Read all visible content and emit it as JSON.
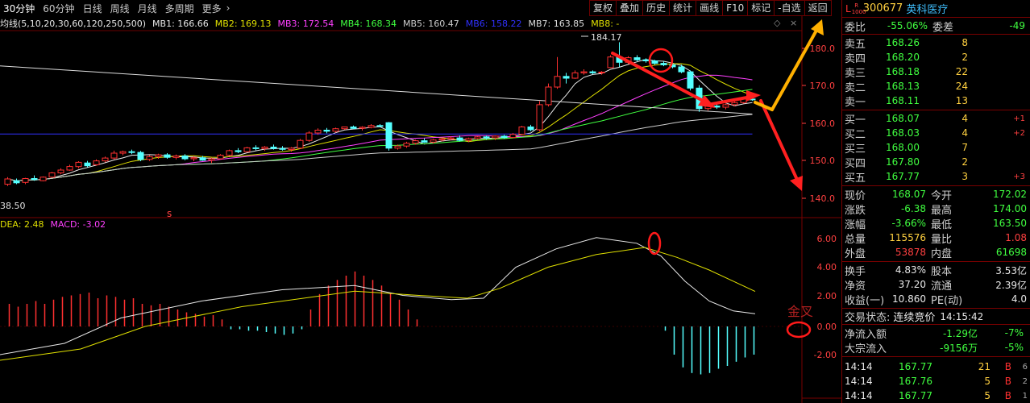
{
  "periods": [
    "30分钟",
    "60分钟",
    "日线",
    "周线",
    "月线",
    "多周期",
    "更多"
  ],
  "toolbar": [
    "复权",
    "叠加",
    "历史",
    "统计",
    "画线",
    "F10",
    "标记",
    "-自选",
    "返回"
  ],
  "ma_legend": {
    "title": "均线(5,10,20,30,60,120,250,500)",
    "items": [
      {
        "label": "MB1: 166.66",
        "color": "#e8e8e8"
      },
      {
        "label": "MB2: 169.13",
        "color": "#e0e000"
      },
      {
        "label": "MB3: 172.54",
        "color": "#ff40ff"
      },
      {
        "label": "MB4: 168.34",
        "color": "#40ff40"
      },
      {
        "label": "MB5: 160.47",
        "color": "#cccccc"
      },
      {
        "label": "MB6: 158.22",
        "color": "#3030ff"
      },
      {
        "label": "MB7: 163.85",
        "color": "#dddddd"
      },
      {
        "label": "MB8: -",
        "color": "#e0e000"
      }
    ]
  },
  "price_axis": [
    "180.0",
    "170.0",
    "160.0",
    "150.0",
    "140.0"
  ],
  "macd_axis": [
    "6.00",
    "4.00",
    "2.00",
    "0.00",
    "-2.00"
  ],
  "price_high_label": "184.17",
  "price_low_label": "38.50",
  "marker_s": "s",
  "macd_legend": {
    "dea": "DEA: 2.48",
    "macd": "MACD: -3.02"
  },
  "annotation_text": "金叉",
  "stock": {
    "marker": "L",
    "badge_top": "R",
    "badge_bottom": "1000",
    "code": "300677",
    "name": "英科医疗"
  },
  "weibi": {
    "label": "委比",
    "value": "-55.06%",
    "label2": "委差",
    "value2": "-49"
  },
  "asks": [
    {
      "label": "卖五",
      "price": "168.26",
      "vol": "8",
      "chg": ""
    },
    {
      "label": "卖四",
      "price": "168.20",
      "vol": "2",
      "chg": ""
    },
    {
      "label": "卖三",
      "price": "168.18",
      "vol": "22",
      "chg": ""
    },
    {
      "label": "卖二",
      "price": "168.13",
      "vol": "24",
      "chg": ""
    },
    {
      "label": "卖一",
      "price": "168.11",
      "vol": "13",
      "chg": ""
    }
  ],
  "bids": [
    {
      "label": "买一",
      "price": "168.07",
      "vol": "4",
      "chg": "+1"
    },
    {
      "label": "买二",
      "price": "168.03",
      "vol": "4",
      "chg": "+2"
    },
    {
      "label": "买三",
      "price": "168.00",
      "vol": "7",
      "chg": ""
    },
    {
      "label": "买四",
      "price": "167.80",
      "vol": "2",
      "chg": ""
    },
    {
      "label": "买五",
      "price": "167.77",
      "vol": "3",
      "chg": "+3"
    }
  ],
  "quote": [
    {
      "l1": "现价",
      "v1": "168.07",
      "c1": "green",
      "l2": "今开",
      "v2": "172.02",
      "c2": "green"
    },
    {
      "l1": "涨跌",
      "v1": "-6.38",
      "c1": "green",
      "l2": "最高",
      "v2": "174.00",
      "c2": "green"
    },
    {
      "l1": "涨幅",
      "v1": "-3.66%",
      "c1": "green",
      "l2": "最低",
      "v2": "163.50",
      "c2": "green"
    },
    {
      "l1": "总量",
      "v1": "115576",
      "c1": "yellow",
      "l2": "量比",
      "v2": "1.08",
      "c2": "red"
    },
    {
      "l1": "外盘",
      "v1": "53878",
      "c1": "red",
      "l2": "内盘",
      "v2": "61698",
      "c2": "green"
    }
  ],
  "finance": [
    {
      "l1": "换手",
      "v1": "4.83%",
      "l2": "股本",
      "v2": "3.53亿"
    },
    {
      "l1": "净资",
      "v1": "37.20",
      "l2": "流通",
      "v2": "2.39亿"
    },
    {
      "l1": "收益(一)",
      "v1": "10.860",
      "l2": "PE(动)",
      "v2": "4.0"
    }
  ],
  "status": {
    "label": "交易状态:",
    "value": "连续竞价",
    "time": "14:15:42"
  },
  "flows": [
    {
      "label": "净流入额",
      "value": "-1.29亿",
      "pct": "-7%"
    },
    {
      "label": "大宗流入",
      "value": "-9156万",
      "pct": "-5%"
    }
  ],
  "trades": [
    {
      "time": "14:14",
      "price": "167.77",
      "vol": "21",
      "side": "B",
      "n": "6"
    },
    {
      "time": "14:14",
      "price": "167.76",
      "vol": "5",
      "side": "B",
      "n": "2"
    },
    {
      "time": "14:14",
      "price": "167.77",
      "vol": "5",
      "side": "B",
      "n": "1"
    }
  ],
  "chart_data": {
    "type": "candlestick",
    "ylim": [
      135,
      187
    ],
    "candles": [
      [
        144,
        146,
        143.5,
        145.5
      ],
      [
        145,
        145.6,
        144,
        144.4
      ],
      [
        144.5,
        145.8,
        144,
        145.6
      ],
      [
        145.6,
        146.5,
        145,
        145.3
      ],
      [
        145,
        146.2,
        144.8,
        146
      ],
      [
        146,
        147.5,
        145.8,
        147.2
      ],
      [
        147.2,
        148.5,
        146.8,
        148
      ],
      [
        148,
        149.5,
        147.8,
        149
      ],
      [
        149,
        150.5,
        148.5,
        150.2
      ],
      [
        150,
        150.6,
        148.8,
        149.2
      ],
      [
        149.5,
        151,
        149.2,
        150.6
      ],
      [
        150.6,
        151.8,
        150.2,
        151.4
      ],
      [
        151.4,
        153.5,
        151,
        152.8
      ],
      [
        152.8,
        153.5,
        152.2,
        153.2
      ],
      [
        153.2,
        153.8,
        152.5,
        153
      ],
      [
        153,
        153.4,
        150.5,
        151
      ],
      [
        151,
        152.2,
        150.6,
        151.8
      ],
      [
        151.8,
        152.6,
        151.2,
        152.3
      ],
      [
        152.3,
        152.8,
        151.2,
        151.6
      ],
      [
        151.6,
        152.4,
        151,
        152
      ],
      [
        152,
        152.5,
        150.8,
        151.2
      ],
      [
        151.2,
        152,
        150.5,
        151.5
      ],
      [
        151.5,
        152,
        150.6,
        150.8
      ],
      [
        150.8,
        151.5,
        150,
        151.2
      ],
      [
        151.2,
        152.5,
        151,
        152.2
      ],
      [
        152.2,
        153.8,
        152,
        153.5
      ],
      [
        153.5,
        154.2,
        152.8,
        153.2
      ],
      [
        153.2,
        154.6,
        153,
        154.3
      ],
      [
        154.3,
        155,
        153.6,
        154.1
      ],
      [
        154.1,
        154.8,
        153.4,
        154.5
      ],
      [
        154.5,
        155.2,
        153.8,
        154.1
      ],
      [
        154.1,
        154.8,
        153.5,
        153.9
      ],
      [
        153.8,
        154.5,
        153.2,
        154.2
      ],
      [
        154.2,
        156.8,
        154,
        156.4
      ],
      [
        156.4,
        159,
        156,
        158.5
      ],
      [
        158.5,
        159.8,
        158,
        159.3
      ],
      [
        159.3,
        159.9,
        158.4,
        159
      ],
      [
        159,
        160,
        158.6,
        159.7
      ],
      [
        159.7,
        160.3,
        159.4,
        160.2
      ],
      [
        160.2,
        160.6,
        159.6,
        159.8
      ],
      [
        159.8,
        160.4,
        159.2,
        160.1
      ],
      [
        160.1,
        161,
        159.8,
        160.6
      ],
      [
        160.6,
        161,
        160.1,
        160.5
      ],
      [
        161.4,
        161.6,
        153.5,
        154.2
      ],
      [
        154.2,
        155.2,
        153.8,
        154.8
      ],
      [
        154.8,
        156,
        154.3,
        155.6
      ],
      [
        155.6,
        156.6,
        155.2,
        156.3
      ],
      [
        156.3,
        157,
        155.7,
        155.9
      ],
      [
        155.9,
        156.8,
        155.5,
        156.5
      ],
      [
        156.5,
        157.2,
        156.1,
        156.8
      ],
      [
        156.8,
        157.6,
        156.4,
        157.1
      ],
      [
        157.1,
        157.8,
        156.1,
        156.4
      ],
      [
        156.4,
        157.2,
        155.9,
        156.9
      ],
      [
        156.9,
        157.6,
        156.6,
        157.4
      ],
      [
        157.4,
        157.8,
        156.6,
        157.1
      ],
      [
        157.1,
        157.8,
        156.5,
        157.6
      ],
      [
        157.6,
        158,
        156.8,
        157.2
      ],
      [
        157.2,
        158.5,
        157,
        158.1
      ],
      [
        158.1,
        160.5,
        157.8,
        160.2
      ],
      [
        160.2,
        160.8,
        159,
        159.4
      ],
      [
        159.4,
        167.5,
        159,
        166.5
      ],
      [
        166.5,
        172.5,
        166,
        171.5
      ],
      [
        171.5,
        180,
        171,
        174.5
      ],
      [
        174.5,
        175.5,
        172.5,
        174
      ],
      [
        174,
        176.2,
        173.8,
        175.5
      ],
      [
        175.5,
        176.5,
        175,
        175.8
      ],
      [
        175.8,
        176.2,
        175.1,
        175.5
      ],
      [
        175.5,
        176,
        175,
        175.7
      ],
      [
        177,
        180.5,
        177.5,
        180
      ],
      [
        180,
        184.17,
        177.2,
        178.5
      ],
      [
        178.5,
        180.2,
        178,
        179.8
      ],
      [
        179.8,
        180.5,
        178.8,
        179.2
      ],
      [
        179.2,
        179.6,
        178.4,
        178.9
      ],
      [
        178.9,
        179.2,
        177.8,
        178.2
      ],
      [
        178.2,
        178.8,
        177.4,
        177.8
      ],
      [
        177.8,
        178.3,
        176.8,
        177.2
      ],
      [
        177.2,
        177.8,
        175.4,
        175.8
      ],
      [
        175.8,
        176.2,
        170.5,
        171.2
      ],
      [
        171.2,
        172,
        164.5,
        165.4
      ],
      [
        165.4,
        166.5,
        164.8,
        166.1
      ],
      [
        166.1,
        167,
        165.3,
        165.8
      ],
      [
        165.8,
        166.8,
        165.2,
        166.5
      ],
      [
        166.5,
        167.4,
        166.1,
        167.1
      ],
      [
        167.1,
        168.4,
        166.8,
        168.1
      ],
      [
        168.1,
        168.6,
        167.6,
        168.07
      ]
    ],
    "macd_hist_first": [
      1.6,
      1.4,
      1.6,
      1.8,
      1.6,
      1.9,
      2.1,
      2.2,
      2.3,
      2.4,
      2.0,
      2.2,
      2.1,
      1.9,
      2.0,
      1.6,
      1.5,
      1.6,
      1.4,
      1.2,
      1.0,
      0.9,
      0.7,
      0.8,
      0.5,
      -0.2,
      -0.2,
      -0.3,
      -0.3,
      -0.4,
      -0.5,
      -0.6,
      -0.5,
      -0.2,
      1.2,
      2.3,
      2.9,
      3.3,
      3.6,
      3.9,
      3.6,
      3.3,
      2.9,
      2.4,
      1.9,
      1.2,
      0.5
    ],
    "macd_hist_last": [
      -0.3,
      -2.0,
      -2.9,
      -3.3,
      -3.4,
      -3.3,
      -3.0,
      -2.8,
      -2.5,
      -2.2,
      -2.0
    ]
  }
}
